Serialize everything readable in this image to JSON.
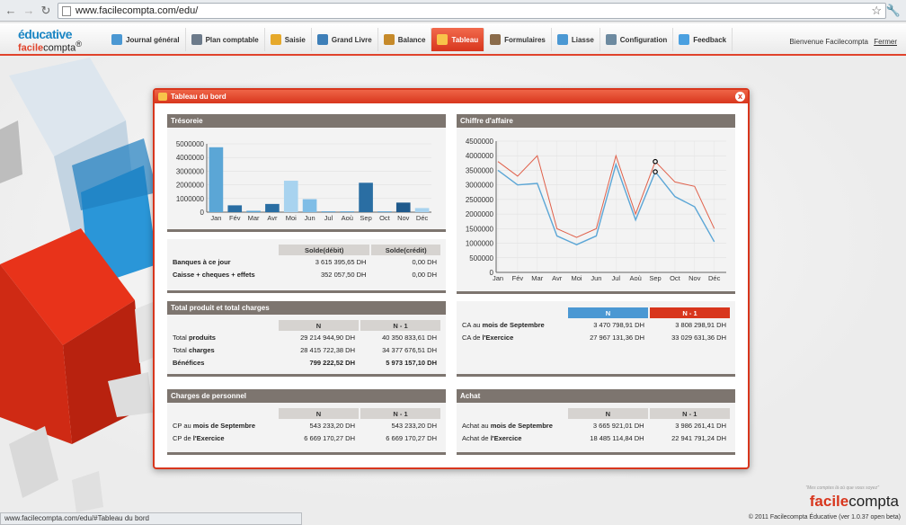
{
  "browser": {
    "url": "www.facilecompta.com/edu/",
    "status_url": "www.facilecompta.com/edu/#Tableau du bord"
  },
  "logo": {
    "line1": "éducative",
    "line2a": "facile",
    "line2b": "compta",
    "reg": "®"
  },
  "menu": [
    {
      "label": "Journal général",
      "icon": "journal-icon"
    },
    {
      "label": "Plan comptable",
      "icon": "plan-icon"
    },
    {
      "label": "Saisie",
      "icon": "pencil-icon"
    },
    {
      "label": "Grand Livre",
      "icon": "book-icon"
    },
    {
      "label": "Balance",
      "icon": "balance-icon"
    },
    {
      "label": "Tableau",
      "icon": "dashboard-icon",
      "active": true
    },
    {
      "label": "Formulaires",
      "icon": "form-icon"
    },
    {
      "label": "Liasse",
      "icon": "liasse-icon"
    },
    {
      "label": "Configuration",
      "icon": "gear-icon"
    },
    {
      "label": "Feedback",
      "icon": "chat-icon"
    }
  ],
  "welcome": {
    "text": "Bienvenue Facilecompta",
    "logout": "Fermer"
  },
  "modal": {
    "title": "Tableau du bord",
    "close": "x"
  },
  "panels": {
    "tresorerie": {
      "title": "Trésoreie"
    },
    "chiffre": {
      "title": "Chiffre d'affaire"
    },
    "banques": {
      "headers": [
        "Solde(débit)",
        "Solde(crédit)"
      ],
      "rows": [
        {
          "label": "Banques à ce jour",
          "debit": "3 615 395,65 DH",
          "credit": "0,00 DH"
        },
        {
          "label": "Caisse + cheques + effets",
          "debit": "352 057,50 DH",
          "credit": "0,00 DH"
        }
      ]
    },
    "total": {
      "title": "Total produit et total charges",
      "headers": [
        "N",
        "N - 1"
      ],
      "rows": [
        {
          "label_a": "Total ",
          "label_b": "produits",
          "n": "29 214 944,90 DH",
          "n1": "40 350 833,61 DH"
        },
        {
          "label_a": "Total ",
          "label_b": "charges",
          "n": "28 415 722,38 DH",
          "n1": "34 377 676,51 DH"
        },
        {
          "label_a": "",
          "label_b": "Bénéfices",
          "n": "799 222,52 DH",
          "n1": "5 973 157,10 DH",
          "bold": true
        }
      ]
    },
    "ca": {
      "headers": [
        "N",
        "N - 1"
      ],
      "rows": [
        {
          "label_a": "CA au ",
          "label_b": "mois de Septembre",
          "n": "3 470 798,91 DH",
          "n1": "3 808 298,91 DH"
        },
        {
          "label_a": "CA de ",
          "label_b": "l'Exercice",
          "n": "27 967 131,36 DH",
          "n1": "33 029 631,36 DH"
        }
      ]
    },
    "personnel": {
      "title": "Charges de personnel",
      "headers": [
        "N",
        "N - 1"
      ],
      "rows": [
        {
          "label_a": "CP au ",
          "label_b": "mois de Septembre",
          "n": "543 233,20 DH",
          "n1": "543 233,20 DH"
        },
        {
          "label_a": "CP de ",
          "label_b": "l'Exercice",
          "n": "6 669 170,27 DH",
          "n1": "6 669 170,27 DH"
        }
      ]
    },
    "achat": {
      "title": "Achat",
      "headers": [
        "N",
        "N - 1"
      ],
      "rows": [
        {
          "label_a": "Achat au ",
          "label_b": "mois de Septembre",
          "n": "3 665 921,01 DH",
          "n1": "3 986 261,41 DH"
        },
        {
          "label_a": "Achat de ",
          "label_b": "l'Exercice",
          "n": "18 485 114,84 DH",
          "n1": "22 941 791,24 DH"
        }
      ]
    }
  },
  "footer": {
    "tagline": "\"Mes comptes là où que vous soyez\"",
    "brand_a": "facile",
    "brand_b": "compta",
    "copyright": "© 2011 Facilecompta Éducative (ver 1.0.37 open beta)"
  },
  "colors": {
    "accent": "#d8361d",
    "blue": "#4b98d3",
    "panel_header": "#7d756f"
  },
  "chart_data": [
    {
      "type": "bar",
      "categories": [
        "Jan",
        "Fév",
        "Mar",
        "Avr",
        "Moi",
        "Jun",
        "Jul",
        "Aoù",
        "Sep",
        "Oct",
        "Nov",
        "Déc"
      ],
      "values": [
        4750000,
        500000,
        100000,
        600000,
        2300000,
        950000,
        60000,
        60000,
        2150000,
        60000,
        700000,
        300000
      ],
      "bar_colors": [
        "#5ba6d6",
        "#2a6ea3",
        "#5ba6d6",
        "#2a6ea3",
        "#a8d3ef",
        "#7fbde6",
        "#5ba6d6",
        "#5ba6d6",
        "#2a6ea3",
        "#5ba6d6",
        "#1f5a8c",
        "#a8d3ef"
      ],
      "yticks": [
        "0",
        "1000000",
        "2000000",
        "3000000",
        "4000000",
        "5000000"
      ],
      "ylim": [
        0,
        5000000
      ]
    },
    {
      "type": "line",
      "categories": [
        "Jan",
        "Fév",
        "Mar",
        "Avr",
        "Moi",
        "Jun",
        "Jul",
        "Aoù",
        "Sep",
        "Oct",
        "Nov",
        "Déc"
      ],
      "series": [
        {
          "values": [
            3800000,
            3300000,
            4000000,
            1500000,
            1200000,
            1500000,
            4000000,
            2000000,
            3800000,
            3100000,
            2950000,
            1500000
          ],
          "color": "#e0604a"
        },
        {
          "values": [
            3500000,
            3000000,
            3050000,
            1250000,
            950000,
            1250000,
            3700000,
            1800000,
            3450000,
            2600000,
            2250000,
            1050000
          ],
          "color": "#5ba6d6"
        }
      ],
      "yticks": [
        "0",
        "500000",
        "1000000",
        "1500000",
        "2000000",
        "2500000",
        "3000000",
        "3500000",
        "4000000",
        "4500000"
      ],
      "ylim": [
        0,
        4500000
      ]
    }
  ]
}
